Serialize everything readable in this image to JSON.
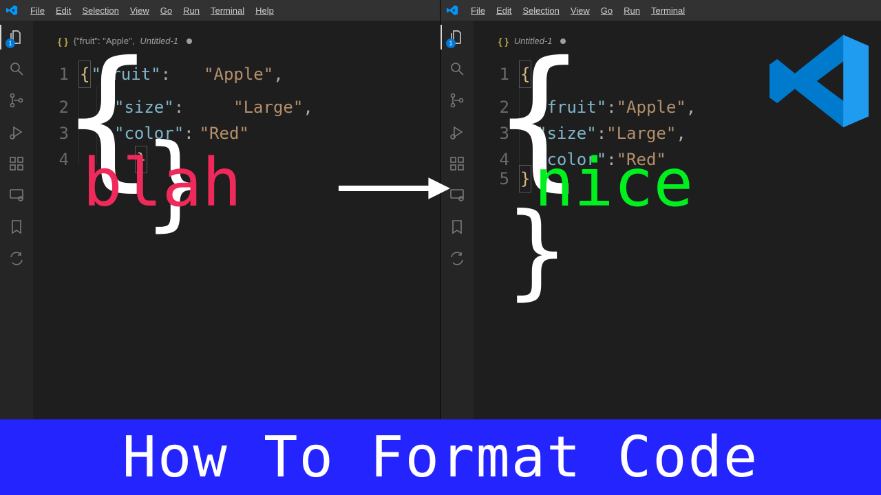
{
  "menu": {
    "file": "File",
    "edit": "Edit",
    "selection": "Selection",
    "view": "View",
    "go": "Go",
    "run": "Run",
    "terminal": "Terminal",
    "help": "Help"
  },
  "activity": {
    "explorer_badge": "1"
  },
  "left": {
    "tab_preview": "{\"fruit\": \"Apple\",",
    "tab_name": "Untitled-1",
    "lines": {
      "l1_open": "{",
      "l1_key": "\"fruit\"",
      "l1_colon": ":",
      "l1_val": "\"Apple\"",
      "l1_comma": ",",
      "l2_key": "\"size\"",
      "l2_colon": ":",
      "l2_val": "\"Large\"",
      "l2_comma": ",",
      "l3_key": "\"color\"",
      "l3_colon": ":",
      "l3_val": "\"Red\"",
      "l4_close": "}",
      "n1": "1",
      "n2": "2",
      "n3": "3",
      "n4": "4"
    }
  },
  "right": {
    "tab_name": "Untitled-1",
    "lines": {
      "l1_open": "{",
      "l2_key": "\"fruit\"",
      "l2_colon": ":",
      "l2_val": "\"Apple\"",
      "l2_comma": ",",
      "l3_key": "\"size\"",
      "l3_colon": ":",
      "l3_val": "\"Large\"",
      "l3_comma": ",",
      "l4_key": "\"color\"",
      "l4_colon": ":",
      "l4_val": "\"Red\"",
      "l5_close": "}",
      "n1": "1",
      "n2": "2",
      "n3": "3",
      "n4": "4",
      "n5": "5"
    }
  },
  "overlay": {
    "left_brace_open": "{",
    "left_brace_close": "}",
    "left_word": "blah",
    "right_brace_open": "{",
    "right_brace_close": "}",
    "right_word": "nice"
  },
  "banner": "How To Format Code"
}
